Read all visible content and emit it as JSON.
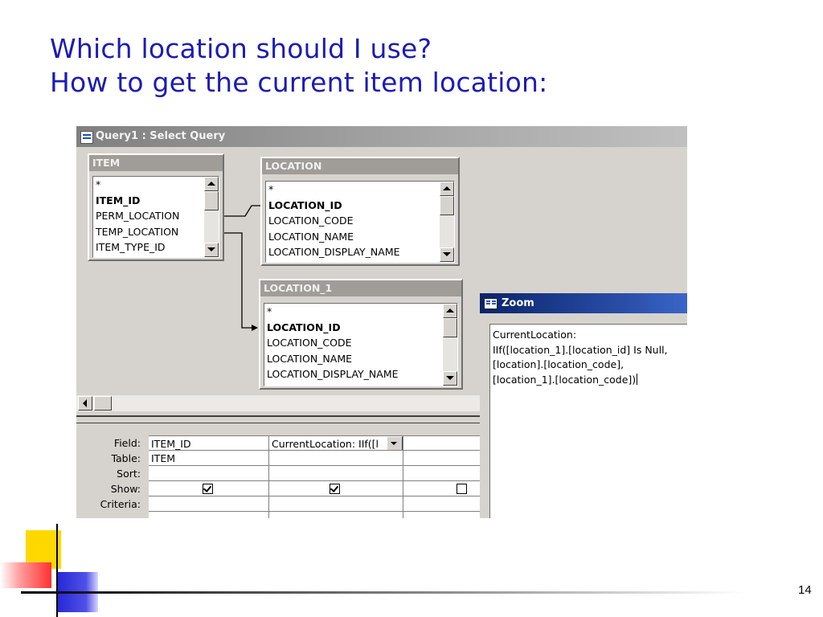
{
  "slide": {
    "title_line1": "Which location should I use?",
    "title_line2": "How to get the current item location:",
    "page_number": "14"
  },
  "window": {
    "title": "Query1 : Select Query",
    "icon": "query-icon"
  },
  "tables": [
    {
      "name": "ITEM",
      "fields": [
        "*",
        "ITEM_ID",
        "PERM_LOCATION",
        "TEMP_LOCATION",
        "ITEM_TYPE_ID"
      ],
      "bold": [
        1
      ]
    },
    {
      "name": "LOCATION",
      "fields": [
        "*",
        "LOCATION_ID",
        "LOCATION_CODE",
        "LOCATION_NAME",
        "LOCATION_DISPLAY_NAME"
      ],
      "bold": [
        1
      ]
    },
    {
      "name": "LOCATION_1",
      "fields": [
        "*",
        "LOCATION_ID",
        "LOCATION_CODE",
        "LOCATION_NAME",
        "LOCATION_DISPLAY_NAME"
      ],
      "bold": [
        1
      ]
    }
  ],
  "grid": {
    "labels": {
      "field": "Field:",
      "table": "Table:",
      "sort": "Sort:",
      "show": "Show:",
      "criteria": "Criteria:"
    },
    "columns": [
      {
        "field": "ITEM_ID",
        "table": "ITEM",
        "sort": "",
        "show": true
      },
      {
        "field": "CurrentLocation: IIf([l",
        "table": "",
        "sort": "",
        "show": true
      },
      {
        "field": "",
        "table": "",
        "sort": "",
        "show": false
      }
    ]
  },
  "zoom": {
    "title": "Zoom",
    "icon": "zoom-icon",
    "expression_lines": [
      "CurrentLocation:",
      "IIf([location_1].[location_id] Is Null,",
      "[location].[location_code],",
      "[location_1].[location_code])"
    ]
  },
  "colors": {
    "title_blue": "#1c1cb4",
    "deco_yellow": "#ffd800",
    "deco_red": "#ff3030",
    "deco_blue": "#2828d8"
  }
}
